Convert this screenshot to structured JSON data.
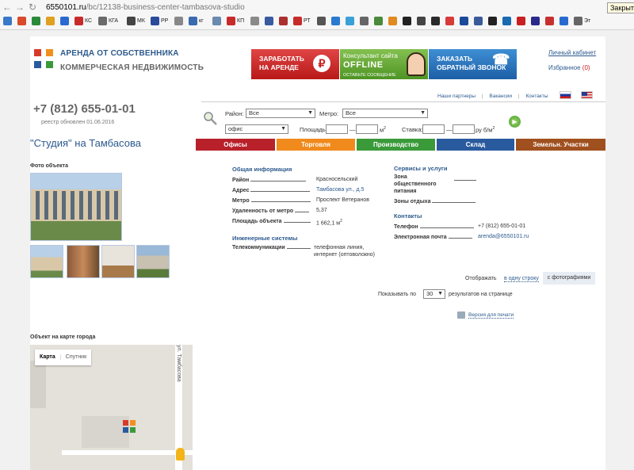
{
  "browser": {
    "url_host": "6550101.ru",
    "url_path": "/bc/12138-business-center-tambasova-studio",
    "close_tooltip": "Закрыть",
    "bookmarks": [
      {
        "label": "",
        "color": "#3a78c8"
      },
      {
        "label": "",
        "color": "#d84a2a"
      },
      {
        "label": "",
        "color": "#2a8a3a"
      },
      {
        "label": "",
        "color": "#e0a020"
      },
      {
        "label": "",
        "color": "#2a6ad0"
      },
      {
        "label": "КС",
        "color": "#c82a2a"
      },
      {
        "label": "КГА",
        "color": "#6a6a6a"
      },
      {
        "label": "МК",
        "color": "#444444"
      },
      {
        "label": "РР",
        "color": "#2a4a9a"
      },
      {
        "label": "",
        "color": "#888888"
      },
      {
        "label": "кг",
        "color": "#3a6ab0"
      },
      {
        "label": "",
        "color": "#6a8ab0"
      },
      {
        "label": "КП",
        "color": "#c82a2a"
      },
      {
        "label": "",
        "color": "#8a8a8a"
      },
      {
        "label": "",
        "color": "#3a5aa0"
      },
      {
        "label": "",
        "color": "#aa3030"
      },
      {
        "label": "РТ",
        "color": "#c82a2a"
      },
      {
        "label": "",
        "color": "#555555"
      },
      {
        "label": "",
        "color": "#2a7ad0"
      },
      {
        "label": "",
        "color": "#3aa0d8"
      },
      {
        "label": "",
        "color": "#666666"
      },
      {
        "label": "",
        "color": "#4a8a3a"
      },
      {
        "label": "",
        "color": "#e08a20"
      },
      {
        "label": "",
        "color": "#222222"
      },
      {
        "label": "",
        "color": "#444444"
      },
      {
        "label": "",
        "color": "#2a2a2a"
      },
      {
        "label": "",
        "color": "#d83a3a"
      },
      {
        "label": "",
        "color": "#1a4a9a"
      },
      {
        "label": "",
        "color": "#3a5a9a"
      },
      {
        "label": "",
        "color": "#222222"
      },
      {
        "label": "",
        "color": "#1a6ab0"
      },
      {
        "label": "",
        "color": "#c82020"
      },
      {
        "label": "",
        "color": "#2a2a8a"
      },
      {
        "label": "",
        "color": "#c83030"
      },
      {
        "label": "",
        "color": "#2a6ad0"
      },
      {
        "label": "Эт",
        "color": "#666666"
      }
    ]
  },
  "brand": {
    "line1": "АРЕНДА ОТ СОБСТВЕННИКА",
    "line2": "КОММЕРЧЕСКАЯ НЕДВИЖИМОСТЬ"
  },
  "banners": {
    "earn_line1": "ЗАРАБОТАТЬ",
    "earn_line2": "НА АРЕНДЕ",
    "consultant_line1": "Консультант сайта",
    "consultant_status": "OFFLINE",
    "consultant_line3": "ОСТАВЬТЕ СООБЩЕНИЕ",
    "callback_line1": "ЗАКАЗАТЬ",
    "callback_line2": "ОБРАТНЫЙ ЗВОНОК"
  },
  "account": {
    "cabinet": "Личный кабинет",
    "favorites": "Избранное",
    "favorites_count": "(0)"
  },
  "contact": {
    "phone": "+7 (812) 655-01-01",
    "updated": "реестр обновлен  01.06.2016"
  },
  "top_links": [
    "Наши партнеры",
    "Вакансии",
    "Контакты"
  ],
  "object_title": "\"Студия\" на Тамбасова",
  "search": {
    "district_label": "Район:",
    "district_value": "Все",
    "metro_label": "Метро:",
    "metro_value": "Все",
    "type_value": "офис",
    "area_label": "Площадь:",
    "area_unit": "м",
    "rate_label": "Ставка:",
    "rate_unit": "ру б/м",
    "dash": "—",
    "sup": "2"
  },
  "categories": [
    {
      "label": "Офисы",
      "color": "#b8202a"
    },
    {
      "label": "Торговля",
      "color": "#f08a1c"
    },
    {
      "label": "Производство",
      "color": "#3a9a3a"
    },
    {
      "label": "Склад",
      "color": "#2a5a9e"
    },
    {
      "label": "Земельн. Участки",
      "color": "#a0501e"
    }
  ],
  "photo_label": "Фото объекта",
  "general": {
    "heading": "Общая информация",
    "rows": [
      {
        "label": "Район",
        "value": "Красносельский",
        "link": false
      },
      {
        "label": "Адрес",
        "value": "Тамбасова ул., д.5",
        "link": true
      },
      {
        "label": "Метро",
        "value": "Проспект Ветеранов",
        "link": false
      },
      {
        "label": "Удаленность от метро",
        "value": "5,37",
        "link": false
      },
      {
        "label": "Площадь объекта",
        "value": "1 662,1 м",
        "link": false
      }
    ]
  },
  "engineering": {
    "heading": "Инженерные системы",
    "label": "Телекоммуникации",
    "value_line1": "телефонная линия,",
    "value_line2": "интернет (оптоволокно)"
  },
  "services": {
    "heading": "Сервисы и услуги",
    "row1_line1": "Зона",
    "row1_line2": "общественного",
    "row1_line3": "питания",
    "row2": "Зоны отдыха"
  },
  "contacts": {
    "heading": "Контакты",
    "phone_label": "Телефон",
    "phone_value": "+7 (812) 655-01-01",
    "email_label": "Электронная почта",
    "email_value": "arenda@6550101.ru"
  },
  "display": {
    "label": "Отображать",
    "option1": "в одну строку",
    "option2": "с фотографиями",
    "per_page_prefix": "Показывать по",
    "per_page_value": "30",
    "per_page_suffix": "результатов на странице",
    "print_link": "Версия для печати"
  },
  "map": {
    "label": "Объект на карте города",
    "tab_map": "Карта",
    "tab_satellite": "Спутник",
    "street": "ул. Тамбасова"
  }
}
